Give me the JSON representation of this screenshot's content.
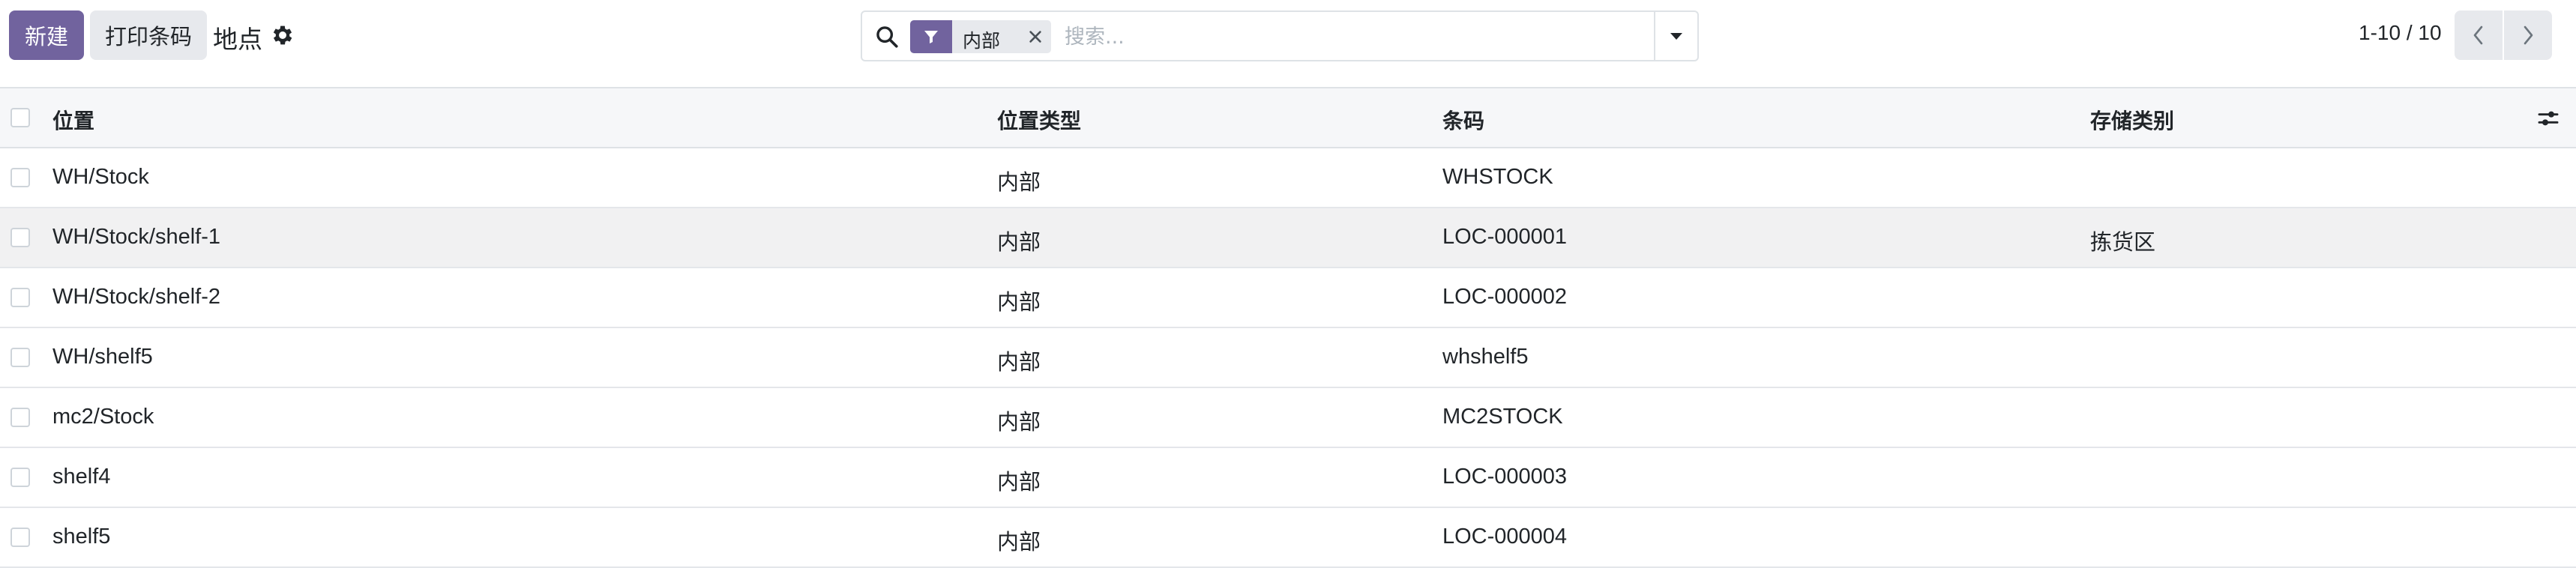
{
  "toolbar": {
    "new_label": "新建",
    "print_label": "打印条码",
    "title": "地点"
  },
  "search": {
    "facet_label": "内部",
    "placeholder": "搜索..."
  },
  "pager": {
    "value": "1-10 / 10"
  },
  "table": {
    "columns": [
      "位置",
      "位置类型",
      "条码",
      "存储类别"
    ],
    "rows": [
      {
        "name": "WH/Stock",
        "type": "内部",
        "barcode": "WHSTOCK",
        "storage": ""
      },
      {
        "name": "WH/Stock/shelf-1",
        "type": "内部",
        "barcode": "LOC-000001",
        "storage": "拣货区"
      },
      {
        "name": "WH/Stock/shelf-2",
        "type": "内部",
        "barcode": "LOC-000002",
        "storage": ""
      },
      {
        "name": "WH/shelf5",
        "type": "内部",
        "barcode": "whshelf5",
        "storage": ""
      },
      {
        "name": "mc2/Stock",
        "type": "内部",
        "barcode": "MC2STOCK",
        "storage": ""
      },
      {
        "name": "shelf4",
        "type": "内部",
        "barcode": "LOC-000003",
        "storage": ""
      },
      {
        "name": "shelf5",
        "type": "内部",
        "barcode": "LOC-000004",
        "storage": ""
      }
    ]
  },
  "colors": {
    "primary": "#71639e",
    "secondary_button": "#e7e9ed",
    "header_bg": "#f6f7f9",
    "highlight_row": "#f1f1f2"
  },
  "icons": [
    "gear-icon",
    "search-icon",
    "filter-icon",
    "close-icon",
    "caret-down-icon",
    "chevron-left-icon",
    "chevron-right-icon",
    "sliders-icon"
  ]
}
